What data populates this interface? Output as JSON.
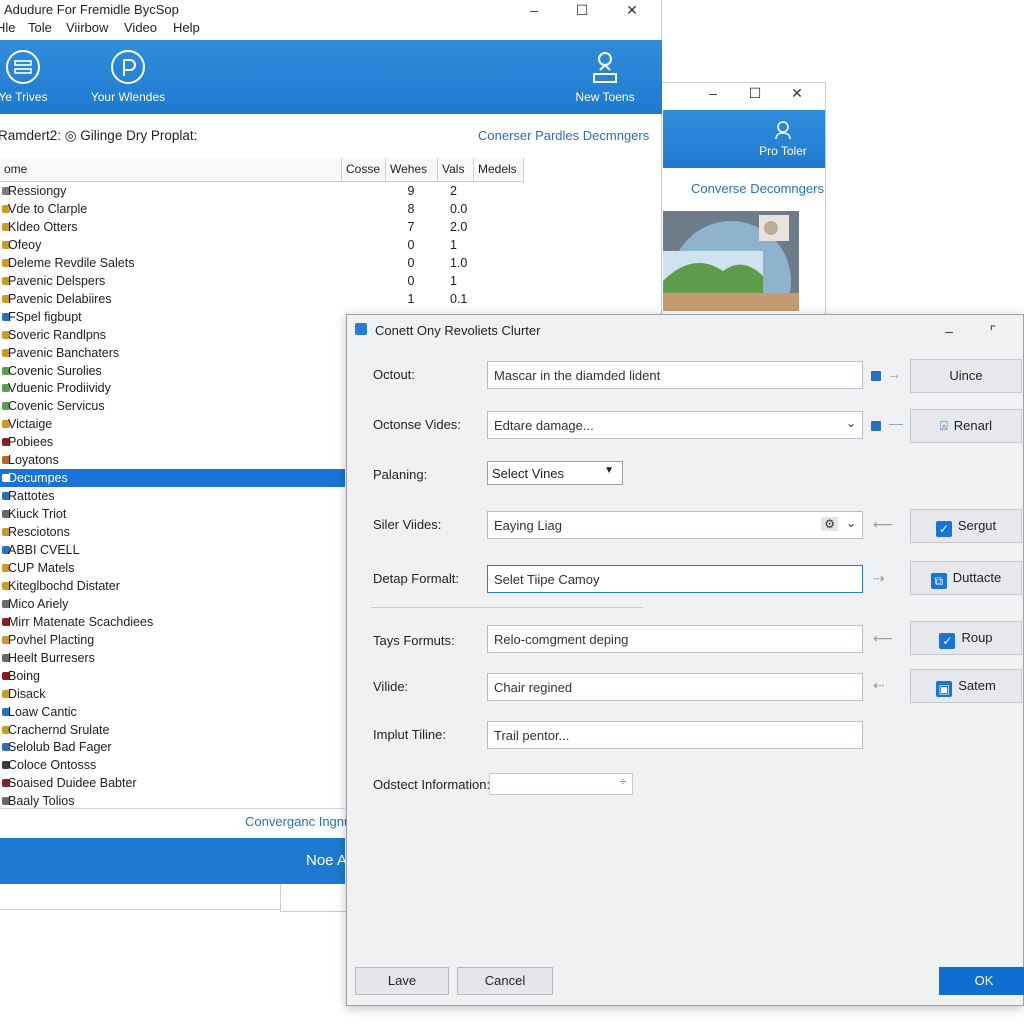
{
  "main_window": {
    "title": "Adudure For Fremidle BycSop",
    "menu": [
      "Hle",
      "Tole",
      "Viirbow",
      "Video",
      "Help"
    ],
    "ribbon": {
      "btn1": "Ye Trives",
      "btn2": "Your Wlendes",
      "btn3": "New Toens"
    },
    "breadcrumb": "Ramdert2: ◎ Gilinge Dry Proplat:",
    "right_link": "Conerser Pardles Decmngers",
    "columns": [
      "ome",
      "Cosse",
      "Wehes",
      "Vals",
      "Medels"
    ],
    "rows": [
      {
        "name": "Ressiongy",
        "v1": "9",
        "v2": "2",
        "color": "#7a7a7a"
      },
      {
        "name": "Vde to Clarple",
        "v1": "8",
        "v2": "0.0",
        "color": "#c89a2a"
      },
      {
        "name": "Kldeo Otters",
        "v1": "7",
        "v2": "2.0",
        "color": "#c89a2a"
      },
      {
        "name": "Ofeoy",
        "v1": "0",
        "v2": "1",
        "color": "#c89a2a"
      },
      {
        "name": "Deleme Revdile Salets",
        "v1": "0",
        "v2": "1.0",
        "color": "#c89a2a"
      },
      {
        "name": "Pavenic Delspers",
        "v1": "0",
        "v2": "1",
        "color": "#c89a2a"
      },
      {
        "name": "Pavenic Delabiires",
        "v1": "1",
        "v2": "0.1",
        "color": "#c89a2a"
      },
      {
        "name": "FSpel figbupt",
        "v1": "",
        "v2": "",
        "color": "#2a6fb8"
      },
      {
        "name": "Soveric Randlpns",
        "v1": "",
        "v2": "",
        "color": "#c89a2a"
      },
      {
        "name": "Pavenic Banchaters",
        "v1": "",
        "v2": "",
        "color": "#c89a2a"
      },
      {
        "name": "Covenic Surolies",
        "v1": "",
        "v2": "",
        "color": "#5aa04a"
      },
      {
        "name": "Vduenic Prodiividy",
        "v1": "",
        "v2": "",
        "color": "#5aa04a"
      },
      {
        "name": "Covenic Servicus",
        "v1": "",
        "v2": "",
        "color": "#5aa04a"
      },
      {
        "name": "Victaige",
        "v1": "",
        "v2": "",
        "color": "#c89a2a"
      },
      {
        "name": "Pobiees",
        "v1": "",
        "v2": "",
        "color": "#8a1f2a"
      },
      {
        "name": "Loyatons",
        "v1": "",
        "v2": "",
        "color": "#b5651d"
      },
      {
        "name": "Decumpes",
        "v1": "",
        "v2": "",
        "color": "#ffffff"
      },
      {
        "name": "Rattotes",
        "v1": "",
        "v2": "",
        "color": "#2a6fb8"
      },
      {
        "name": "Kiuck Triot",
        "v1": "",
        "v2": "",
        "color": "#6a6a6a"
      },
      {
        "name": "Resciotons",
        "v1": "",
        "v2": "",
        "color": "#c89a2a"
      },
      {
        "name": "ABBI CVELL",
        "v1": "",
        "v2": "",
        "color": "#2a6fb8"
      },
      {
        "name": "CUP Matels",
        "v1": "",
        "v2": "",
        "color": "#c89a2a"
      },
      {
        "name": "Kiteglbochd Distater",
        "v1": "",
        "v2": "",
        "color": "#c89a2a"
      },
      {
        "name": "Mico Ariely",
        "v1": "",
        "v2": "",
        "color": "#6a6a6a"
      },
      {
        "name": "Mirr Matenate Scachdiees",
        "v1": "",
        "v2": "",
        "color": "#8a1f2a"
      },
      {
        "name": "Povhel Placting",
        "v1": "",
        "v2": "",
        "color": "#c89a2a"
      },
      {
        "name": "Heelt Burresers",
        "v1": "",
        "v2": "",
        "color": "#6a6a6a"
      },
      {
        "name": "Boing",
        "v1": "",
        "v2": "",
        "color": "#8a1f2a"
      },
      {
        "name": "Disack",
        "v1": "",
        "v2": "",
        "color": "#c89a2a"
      },
      {
        "name": "Loaw Cantic",
        "v1": "",
        "v2": "",
        "color": "#2a6fb8"
      },
      {
        "name": "Crachernd Srulate",
        "v1": "",
        "v2": "",
        "color": "#c89a2a"
      },
      {
        "name": "Selolub Bad Fager",
        "v1": "",
        "v2": "",
        "color": "#2a6fb8"
      },
      {
        "name": "Coloce Ontosss",
        "v1": "",
        "v2": "",
        "color": "#3a3a3a"
      },
      {
        "name": "Soaised Duidee Babter",
        "v1": "",
        "v2": "",
        "color": "#8a1f2a"
      },
      {
        "name": "Baaly Tolios",
        "v1": "",
        "v2": "",
        "color": "#6a6a6a"
      }
    ],
    "selected_index": 16,
    "footer_link": "Converganc Ingnu",
    "footer_button": "Noe A"
  },
  "back_window": {
    "ribbon_label": "Pro Toler",
    "link": "Converse Decomngers"
  },
  "dialog": {
    "title": "Conett Ony Revoliets Clurter",
    "rows": [
      {
        "label": "Octout:",
        "value": "Mascar in the diamded lident",
        "side": "Uince",
        "side_check": false
      },
      {
        "label": "Octonse Vides:",
        "value": "Edtare damage...",
        "side": "Renarl",
        "side_check": false
      },
      {
        "label": "Palaning:",
        "value": "Select Vines"
      },
      {
        "label": "Siler Viides:",
        "value": "Eaying Liag",
        "side": "Sergut",
        "side_check": true
      },
      {
        "label": "Detap Formalt:",
        "value": "Selet Tiipe Camoy",
        "side": "Duttacte",
        "side_check": false
      },
      {
        "label": "Tays Formuts:",
        "value": "Relo-comgment deping",
        "side": "Roup",
        "side_check": true
      },
      {
        "label": "Vilide:",
        "value": "Chair regined",
        "side": "Satem",
        "side_check": false
      },
      {
        "label": "Implut Tiline:",
        "value": "Trail pentor..."
      },
      {
        "label": "Odstect Information:",
        "value": ""
      }
    ],
    "btn_save": "Lave",
    "btn_cancel": "Cancel",
    "btn_ok": "OK"
  }
}
